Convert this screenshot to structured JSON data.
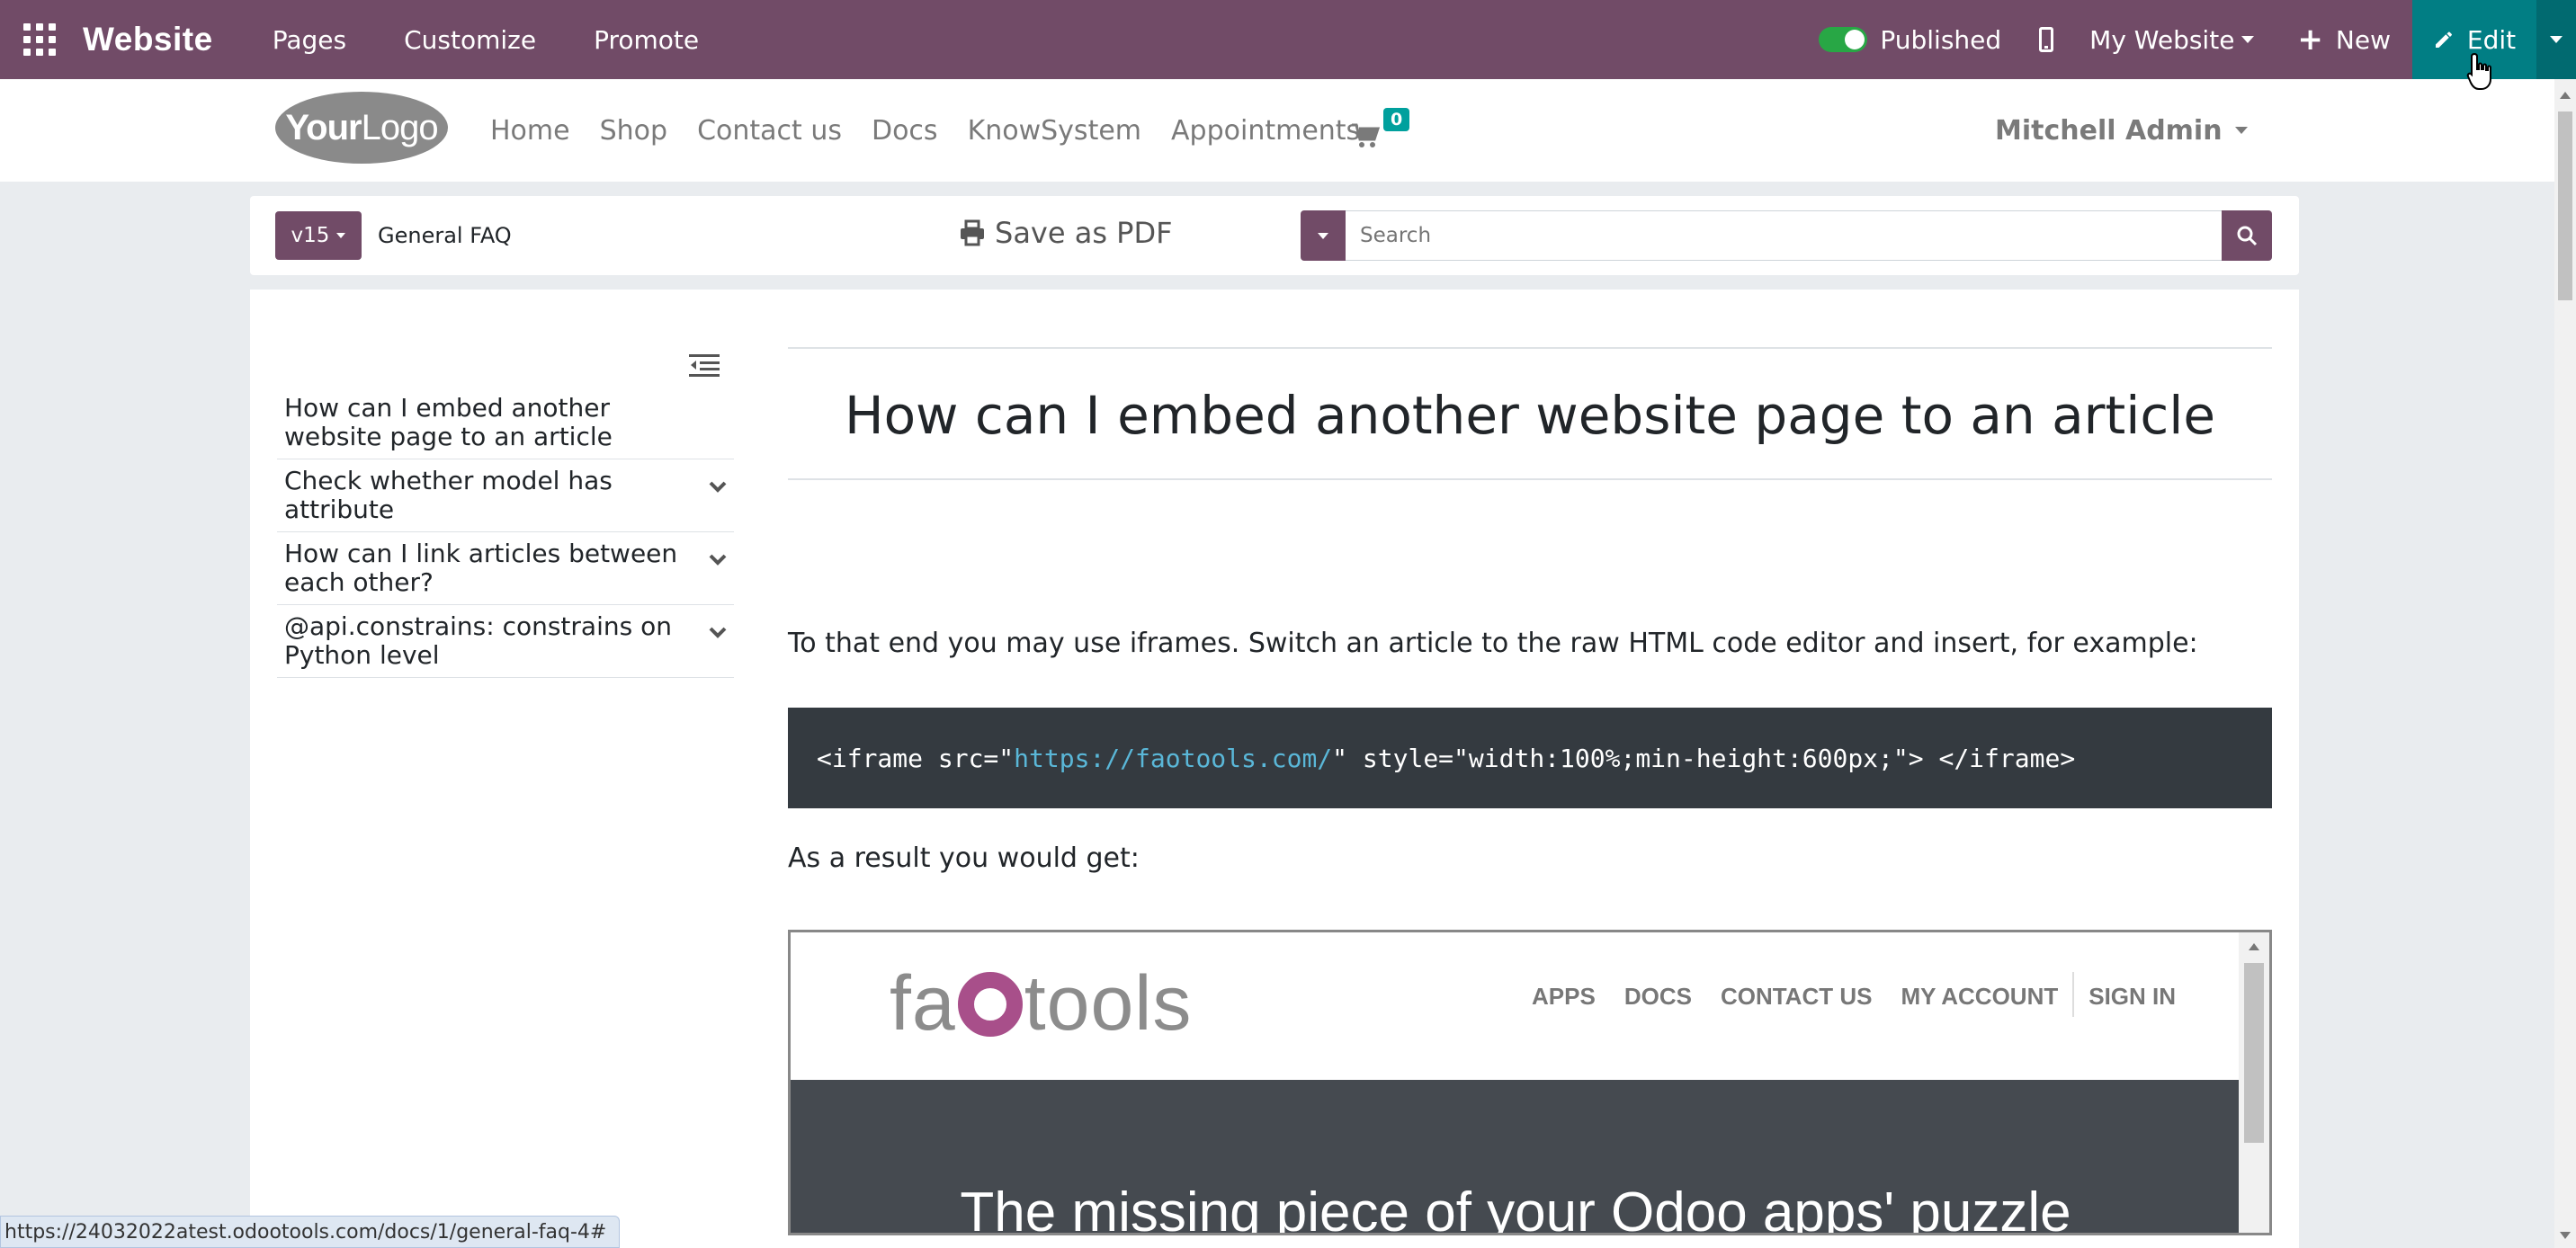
{
  "topbar": {
    "brand": "Website",
    "nav": [
      "Pages",
      "Customize",
      "Promote"
    ],
    "published_label": "Published",
    "my_website_label": "My Website",
    "new_label": "New",
    "edit_label": "Edit",
    "colors": {
      "bar": "#714b67",
      "edit": "#017e84",
      "toggle_on": "#28a745"
    }
  },
  "site_header": {
    "logo_text_bold": "Your",
    "logo_text": "Logo",
    "nav": [
      "Home",
      "Shop",
      "Contact us",
      "Docs",
      "KnowSystem",
      "Appointments"
    ],
    "cart_count": "0",
    "user_name": "Mitchell Admin"
  },
  "toolbar": {
    "version_label": "v15",
    "doc_title": "General FAQ",
    "save_pdf_label": "Save as PDF",
    "search_placeholder": "Search"
  },
  "toc": {
    "items": [
      {
        "label": "How can I embed another website page to an article",
        "expandable": false
      },
      {
        "label": "Check whether model has attribute",
        "expandable": true
      },
      {
        "label": "How can I link articles between each other?",
        "expandable": true
      },
      {
        "label": "@api.constrains: constrains on Python level",
        "expandable": true
      }
    ]
  },
  "article": {
    "title": "How can I embed another website page to an article",
    "intro": "To that end you may use iframes. Switch an article to the raw HTML code editor and insert, for example:",
    "code_before": "<iframe src=\"",
    "code_url": "https://faotools.com/",
    "code_after": "\" style=\"width:100%;min-height:600px;\"> </iframe>",
    "result_text": "As a result you would get:"
  },
  "iframe": {
    "logo_left": "fa",
    "logo_right": "tools",
    "nav": [
      "APPS",
      "DOCS",
      "CONTACT US",
      "MY ACCOUNT"
    ],
    "sign_in": "SIGN IN",
    "hero": "The missing piece of your Odoo apps' puzzle",
    "colors": {
      "logo_o": "#a84f8a",
      "hero_bg": "#454a50"
    }
  },
  "status_url": "https://24032022atest.odootools.com/docs/1/general-faq-4#"
}
